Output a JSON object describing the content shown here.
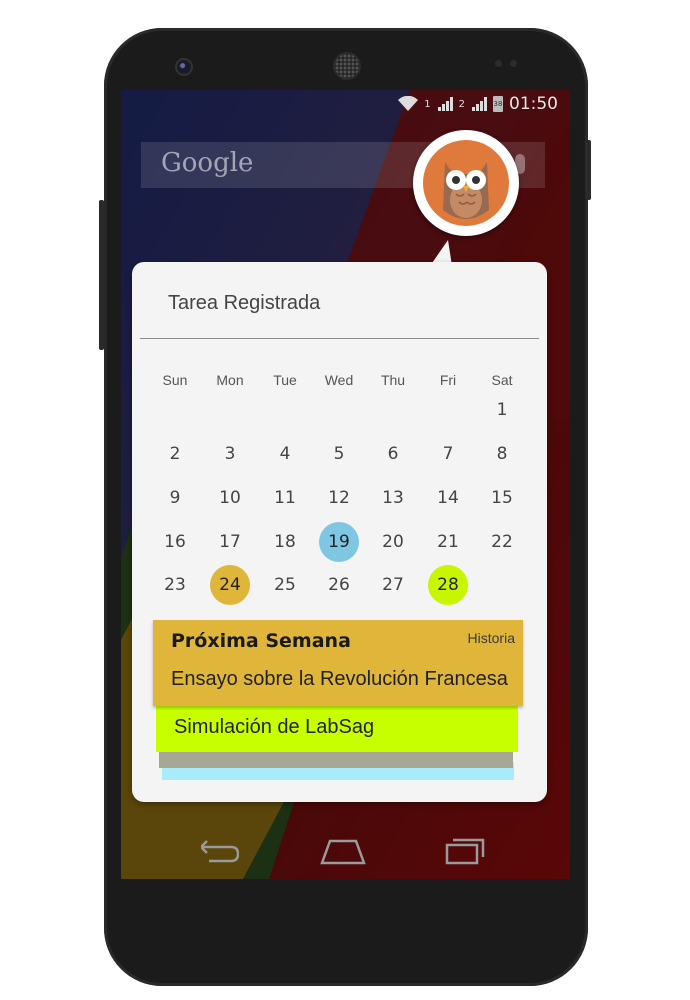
{
  "status_bar": {
    "time": "01:50",
    "sim1_label": "1",
    "sim2_label": "2",
    "battery_label": "38",
    "icons": [
      "wifi-icon",
      "signal-icon",
      "signal-icon",
      "battery-icon"
    ]
  },
  "home": {
    "search_logo_text": "Google"
  },
  "popup": {
    "title": "Tarea Registrada",
    "weekdays": [
      "Sun",
      "Mon",
      "Tue",
      "Wed",
      "Thu",
      "Fri",
      "Sat"
    ],
    "calendar_weeks": [
      [
        "",
        "",
        "",
        "",
        "",
        "",
        "1"
      ],
      [
        "2",
        "3",
        "4",
        "5",
        "6",
        "7",
        "8"
      ],
      [
        "9",
        "10",
        "11",
        "12",
        "13",
        "14",
        "15"
      ],
      [
        "16",
        "17",
        "18",
        "19",
        "20",
        "21",
        "22"
      ],
      [
        "23",
        "24",
        "25",
        "26",
        "27",
        "28",
        ""
      ]
    ],
    "highlighted_days": [
      {
        "day": "19",
        "color": "#7fc6e2"
      },
      {
        "day": "24",
        "color": "#e0b63a"
      },
      {
        "day": "28",
        "color": "#c8f500"
      }
    ],
    "cards": {
      "front": {
        "week_label": "Próxima Semana",
        "subject": "Historia",
        "task": "Ensayo sobre la Revolución Francesa",
        "color": "#e0b63a"
      },
      "second": {
        "task": "Simulación de LabSag",
        "color": "#c8ff00"
      },
      "third_color": "#a6a895",
      "fourth_color": "#a8ecfb"
    }
  },
  "avatar": {
    "icon": "owl-avatar-icon",
    "background": "#e07a3c"
  },
  "nav_bar": {
    "icons": [
      "back-icon",
      "home-icon",
      "recents-icon"
    ]
  }
}
